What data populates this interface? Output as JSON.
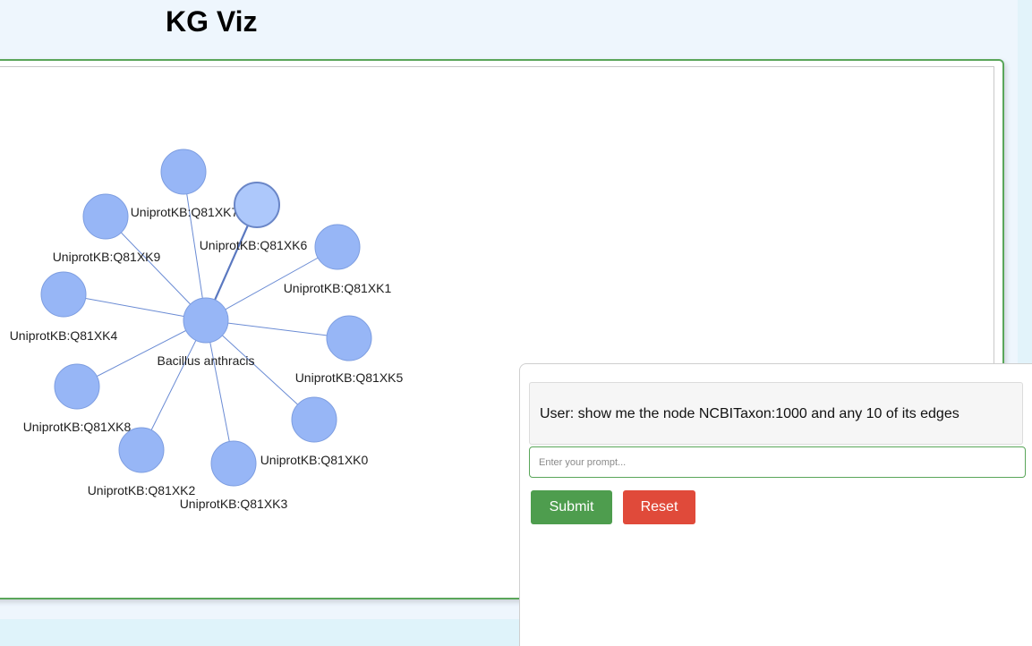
{
  "app": {
    "title": "KG Viz"
  },
  "graph": {
    "colors": {
      "node": "#97b6f6",
      "node_stroke": "#7d9de0",
      "highlight_node": "#adc8fb",
      "highlight_stroke": "#6a86c7",
      "edge": "#6a8bd4",
      "highlight_edge": "#5a78c0"
    },
    "center": {
      "id": "center",
      "label": "Bacillus anthracis"
    },
    "nodes": [
      {
        "id": "n7",
        "label": "UniprotKB:Q81XK7"
      },
      {
        "id": "n6",
        "label": "UniprotKB:Q81XK6",
        "highlighted": true
      },
      {
        "id": "n9",
        "label": "UniprotKB:Q81XK9"
      },
      {
        "id": "n1",
        "label": "UniprotKB:Q81XK1"
      },
      {
        "id": "n4",
        "label": "UniprotKB:Q81XK4"
      },
      {
        "id": "n5",
        "label": "UniprotKB:Q81XK5"
      },
      {
        "id": "n8",
        "label": "UniprotKB:Q81XK8"
      },
      {
        "id": "n0",
        "label": "UniprotKB:Q81XK0"
      },
      {
        "id": "n2",
        "label": "UniprotKB:Q81XK2"
      },
      {
        "id": "n3",
        "label": "UniprotKB:Q81XK3"
      }
    ]
  },
  "chat": {
    "messages": [
      {
        "text": "User: show me the node NCBITaxon:1000 and any 10 of its edges"
      }
    ],
    "input": {
      "value": "",
      "placeholder": "Enter your prompt..."
    },
    "submit_label": "Submit",
    "reset_label": "Reset",
    "colors": {
      "submit": "#4e9d4e",
      "reset": "#e04a3a",
      "accent_border": "#5aa65a"
    }
  }
}
